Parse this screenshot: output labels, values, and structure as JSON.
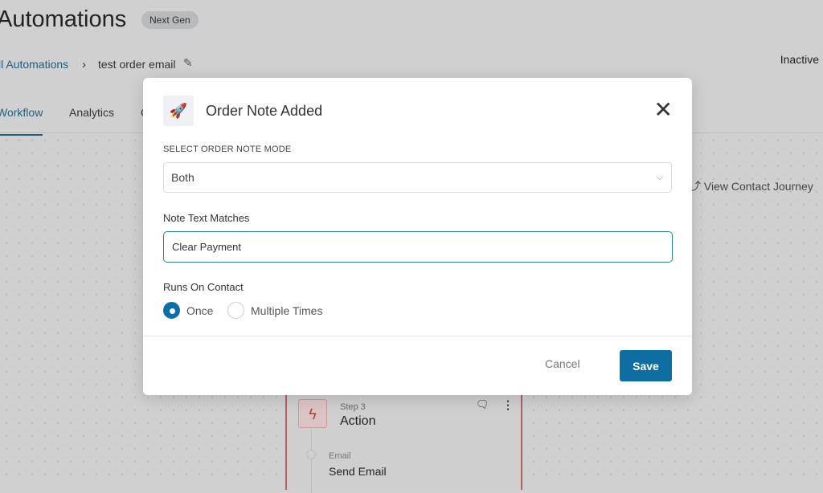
{
  "header": {
    "title": "Automations",
    "badge": "Next Gen",
    "status": "Inactive"
  },
  "breadcrumb": {
    "parent": "ll Automations",
    "separator": "›",
    "current": "test order email"
  },
  "tabs": [
    {
      "label": "Workflow",
      "active": true
    },
    {
      "label": "Analytics"
    },
    {
      "label": "C"
    }
  ],
  "canvas": {
    "view_journey": "View Contact Journey",
    "node": {
      "step": "Step 3",
      "title": "Action",
      "sub_label": "Email",
      "sub_title": "Send Email"
    }
  },
  "modal": {
    "title": "Order Note Added",
    "icon": "rocket-icon",
    "mode_label": "SELECT ORDER NOTE MODE",
    "mode_value": "Both",
    "note_label": "Note Text Matches",
    "note_value": "Clear Payment",
    "runs_label": "Runs On Contact",
    "options": [
      {
        "label": "Once",
        "selected": true
      },
      {
        "label": "Multiple Times",
        "selected": false
      }
    ],
    "cancel": "Cancel",
    "save": "Save"
  },
  "colors": {
    "accent": "#0f6ea1",
    "action_border": "#b46060"
  }
}
